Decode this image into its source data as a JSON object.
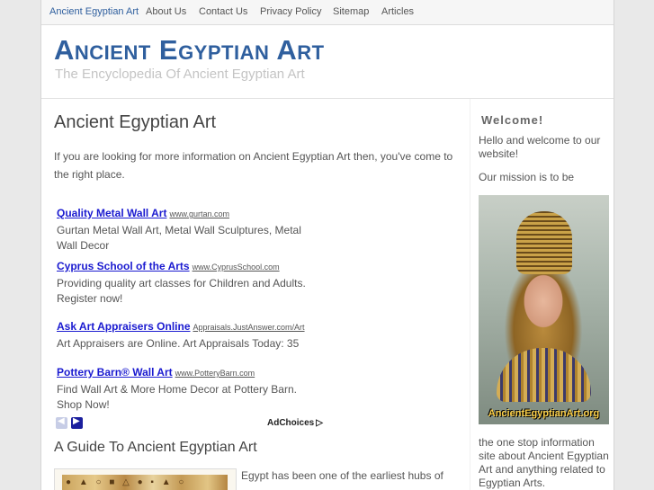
{
  "nav": {
    "items": [
      {
        "label": "Ancient Egyptian Art"
      },
      {
        "label": "About Us"
      },
      {
        "label": "Contact Us"
      },
      {
        "label": "Privacy Policy"
      },
      {
        "label": "Sitemap"
      },
      {
        "label": "Articles"
      }
    ]
  },
  "header": {
    "title": "Ancient Egyptian Art",
    "tagline": "The Encyclopedia Of Ancient Egyptian Art"
  },
  "main": {
    "title": "Ancient Egyptian Art",
    "intro": "If you are looking for more information on Ancient Egyptian Art then, you've come to the right place."
  },
  "ads": {
    "items": [
      {
        "title": "Quality Metal Wall Art",
        "url": "www.gurtan.com",
        "desc": "Gurtan Metal Wall Art, Metal Wall Sculptures, Metal Wall Decor"
      },
      {
        "title": "Cyprus School of the Arts",
        "url": "www.CyprusSchool.com",
        "desc": "Providing quality art classes for Children and Adults. Register now!"
      },
      {
        "title": "Ask Art Appraisers Online",
        "url": "Appraisals.JustAnswer.com/Art",
        "desc": "Art Appraisers are Online. Art Appraisals Today: 35"
      },
      {
        "title": "Pottery Barn® Wall Art",
        "url": "www.PotteryBarn.com",
        "desc": "Find Wall Art & More Home Decor at Pottery Barn. Shop Now!"
      }
    ],
    "adchoices_label": "AdChoices"
  },
  "guide": {
    "title": "A Guide To Ancient Egyptian Art",
    "text": "Egypt has been one of the earliest hubs of"
  },
  "sidebar": {
    "welcome_title": "Welcome!",
    "welcome_text": "Hello and welcome to our website!",
    "mission_text": "Our mission is to be",
    "image_caption": "AncientEgyptianArt.org",
    "after_text": "the one stop information site about Ancient Egyptian Art and anything related to Egyptian Arts."
  },
  "colors": {
    "accent": "#2f5f9e",
    "ad_link": "#1a1ad0"
  }
}
